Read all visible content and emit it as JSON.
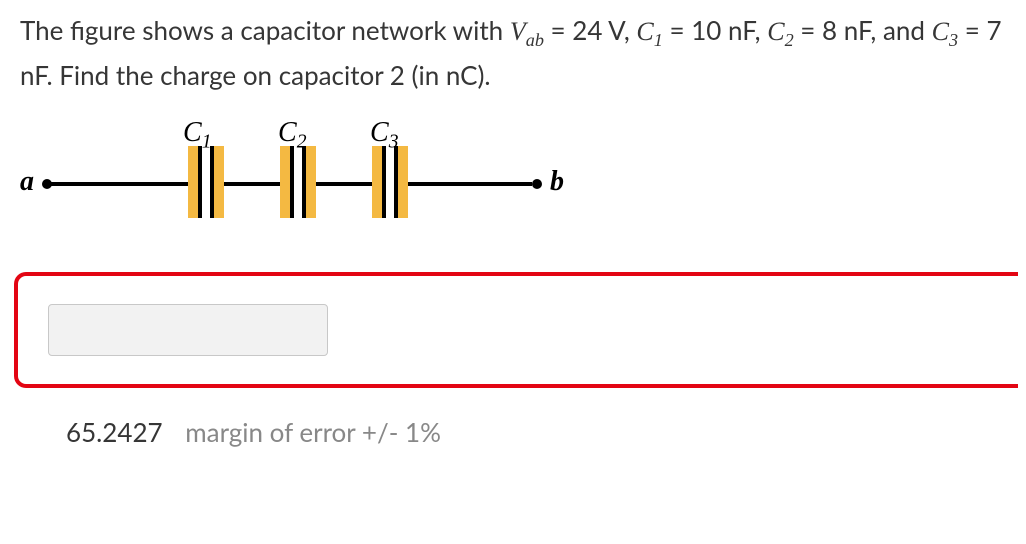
{
  "question": {
    "intro": "The figure shows a capacitor network with ",
    "vab_symbol_pre": "V",
    "vab_symbol_sub": "ab",
    "eq1": " = 24 V, ",
    "c1_symbol_pre": "C",
    "c1_symbol_sub": "1",
    "eq2": " = 10 nF, ",
    "c2_symbol_pre": "C",
    "c2_symbol_sub": "2",
    "eq3": " = 8 nF, and ",
    "c3_symbol_pre": "C",
    "c3_symbol_sub": "3",
    "eq4": " = 7 nF. Find the charge on capacitor 2 (in nC)."
  },
  "figure": {
    "node_a": "a",
    "node_b": "b",
    "cap1_label_pre": "C",
    "cap1_label_sub": "1",
    "cap2_label_pre": "C",
    "cap2_label_sub": "2",
    "cap3_label_pre": "C",
    "cap3_label_sub": "3"
  },
  "answer": {
    "value": "",
    "correct": "65.2427",
    "margin_note": "margin of error +/- 1%"
  }
}
